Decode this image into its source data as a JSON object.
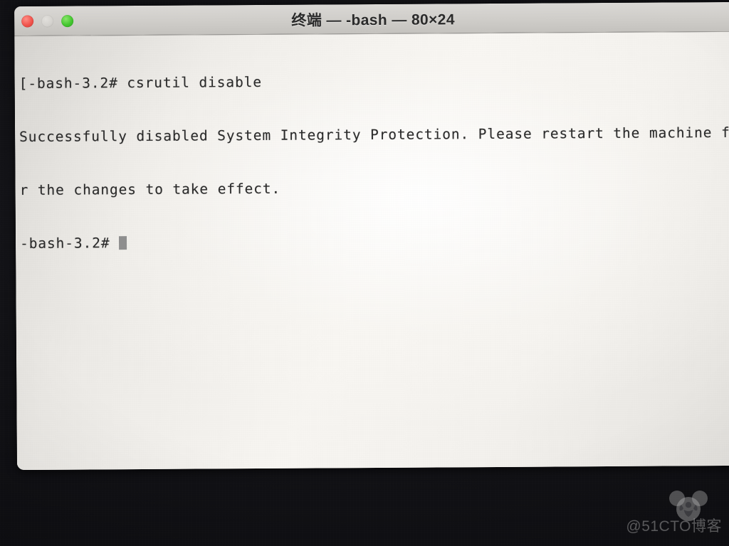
{
  "window": {
    "title": "终端 — -bash — 80×24",
    "traffic_lights": [
      {
        "name": "close",
        "label": "关闭",
        "color": "#f0534c"
      },
      {
        "name": "minimize",
        "label": "最小化",
        "color": "#d3d1cd"
      },
      {
        "name": "zoom",
        "label": "缩放",
        "color": "#43c62f"
      }
    ]
  },
  "terminal": {
    "background_color": "#f6f4f0",
    "text_color": "#2a2a2a",
    "cursor_color": "#8e8e8e",
    "columns": 80,
    "rows": 24,
    "lines": [
      "[-bash-3.2# csrutil disable",
      "Successfully disabled System Integrity Protection. Please restart the machine fo",
      "r the changes to take effect.",
      "-bash-3.2# "
    ],
    "prompt": "-bash-3.2#",
    "command": "csrutil disable",
    "output": "Successfully disabled System Integrity Protection. Please restart the machine for the changes to take effect."
  },
  "watermark": {
    "text": "@51CTO博客",
    "logo_name": "panda-logo"
  }
}
